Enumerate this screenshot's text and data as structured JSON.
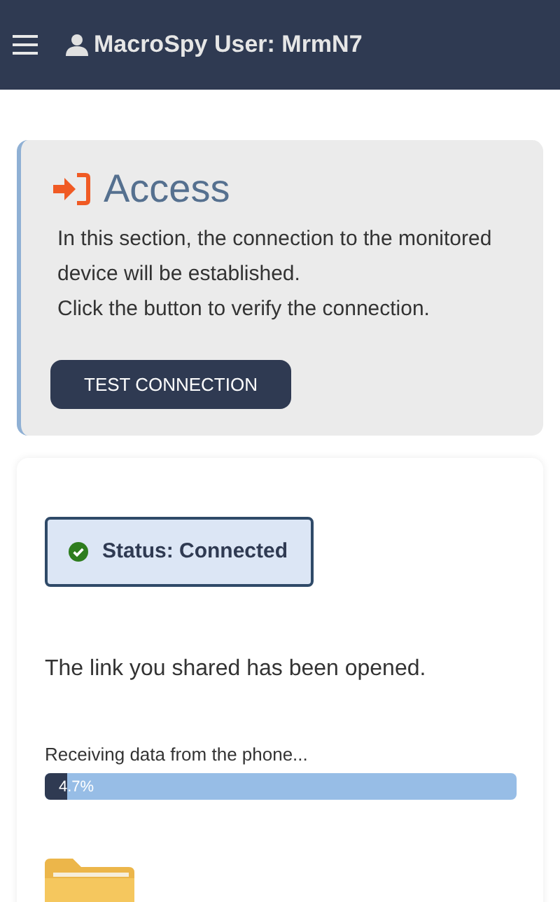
{
  "header": {
    "title": "MacroSpy User: MrmN7"
  },
  "access": {
    "title": "Access",
    "paragraphs": [
      "In this section, the connection to the monitored device will be established.",
      "Click the button to verify the connection."
    ],
    "button": "TEST CONNECTION"
  },
  "status": {
    "text": "Status: Connected",
    "connected": true
  },
  "message": "The link you shared has been opened.",
  "progress": {
    "label": "Receiving data from the phone...",
    "level": 0.047,
    "reading": "4.7%"
  }
}
